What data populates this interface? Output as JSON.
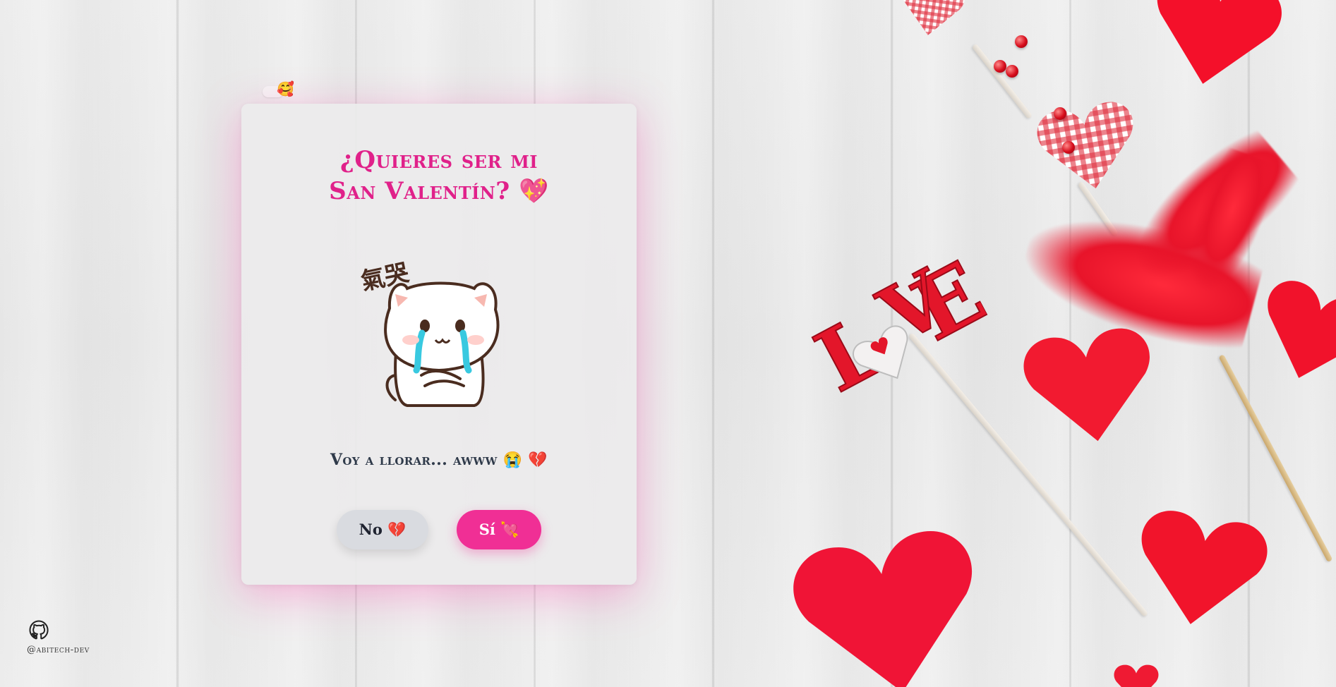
{
  "card": {
    "sticker_emoji": "🥰",
    "title_line1": "¿Quieres ser mi",
    "title_line2": "San Valentín? 💖",
    "sticker_text": "氣哭",
    "message": "Voy a llorar... awww 😭 💔",
    "no_button": "No 💔",
    "yes_button": "Sí 💘"
  },
  "footer": {
    "handle": "@abitech-dev"
  },
  "colors": {
    "title": "#e0218a",
    "yes_button": "#f02f95",
    "no_button": "#d9dbe0",
    "message": "#2f3a4a"
  },
  "icons": [
    "github-icon"
  ]
}
